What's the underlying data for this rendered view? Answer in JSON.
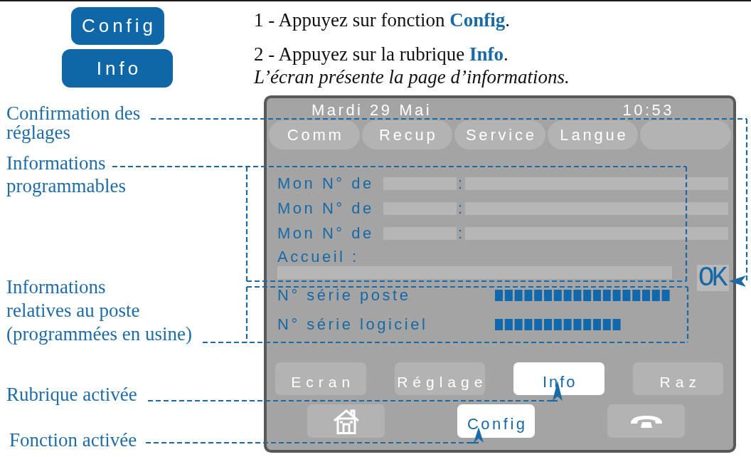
{
  "top_keys": [
    {
      "label": "Config"
    },
    {
      "label": "Info"
    }
  ],
  "instructions": {
    "steps": [
      "1 - Appuyez sur fonction **Config**.",
      "2 - Appuyez sur la rubrique **Info**."
    ],
    "note": "L’écran présente la page d’informations."
  },
  "callouts": [
    {
      "lines": [
        "Confirmation des",
        "réglages"
      ]
    },
    {
      "lines": [
        "Informations",
        "programmables"
      ]
    },
    {
      "lines": [
        "Informations",
        "relatives au poste",
        "(programmées en usine)"
      ]
    },
    {
      "lines": [
        "Rubrique activée"
      ]
    },
    {
      "lines": [
        "Fonction activée"
      ]
    }
  ],
  "screen": {
    "date": "Mardi 29 Mai",
    "time": "10:53",
    "tabs": [
      {
        "label": "Comm",
        "selected": false
      },
      {
        "label": "Recup",
        "selected": false
      },
      {
        "label": "Service",
        "selected": false
      },
      {
        "label": "Langue",
        "selected": false
      }
    ],
    "number_rows": [
      {
        "label": "Mon N° de",
        "separator": ":"
      },
      {
        "label": "Mon N° de",
        "separator": ":"
      },
      {
        "label": "Mon N° de",
        "separator": ":"
      }
    ],
    "welcome": {
      "label": "Accueil :"
    },
    "ok_key": {
      "label": "OK"
    },
    "serial_rows": [
      {
        "label": "N° série poste"
      },
      {
        "label": "N° série logiciel"
      }
    ],
    "rubric_keys": [
      {
        "label": "Ecran",
        "selected": false
      },
      {
        "label": "Réglage",
        "selected": false
      },
      {
        "label": "Info",
        "selected": true
      },
      {
        "label": "Raz",
        "selected": false
      }
    ],
    "function_keys": [
      {
        "kind": "home",
        "selected": false
      },
      {
        "kind": "label",
        "label": "Config",
        "selected": true
      },
      {
        "kind": "hangup",
        "selected": false
      }
    ]
  }
}
